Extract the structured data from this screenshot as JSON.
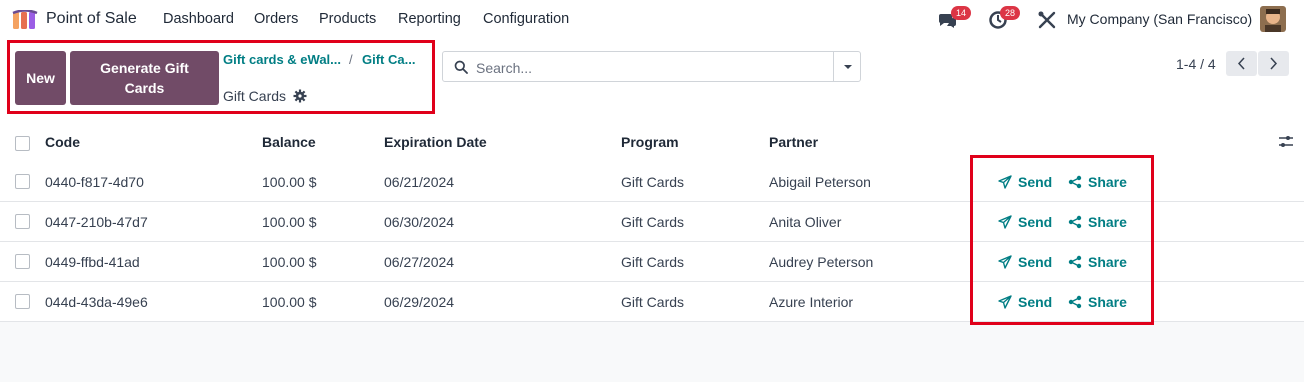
{
  "app": {
    "name": "Point of Sale"
  },
  "menu": [
    "Dashboard",
    "Orders",
    "Products",
    "Reporting",
    "Configuration"
  ],
  "systray": {
    "messages_count": "14",
    "activities_count": "28",
    "company": "My Company (San Francisco)"
  },
  "control": {
    "new_label": "New",
    "generate_label_line1": "Generate Gift",
    "generate_label_line2": "Cards",
    "breadcrumbs": [
      "Gift cards & eWal...",
      "Gift Ca..."
    ],
    "breadcrumb_separator": "/",
    "view_title": "Gift Cards",
    "search_placeholder": "Search...",
    "pager": "1-4 / 4"
  },
  "table": {
    "columns": [
      "Code",
      "Balance",
      "Expiration Date",
      "Program",
      "Partner"
    ],
    "rows": [
      {
        "code": "0440-f817-4d70",
        "balance": "100.00 $",
        "expiration": "06/21/2024",
        "program": "Gift Cards",
        "partner": "Abigail Peterson"
      },
      {
        "code": "0447-210b-47d7",
        "balance": "100.00 $",
        "expiration": "06/30/2024",
        "program": "Gift Cards",
        "partner": "Anita Oliver"
      },
      {
        "code": "0449-ffbd-41ad",
        "balance": "100.00 $",
        "expiration": "06/27/2024",
        "program": "Gift Cards",
        "partner": "Audrey Peterson"
      },
      {
        "code": "044d-43da-49e6",
        "balance": "100.00 $",
        "expiration": "06/29/2024",
        "program": "Gift Cards",
        "partner": "Azure Interior"
      }
    ],
    "send_label": "Send",
    "share_label": "Share"
  },
  "colors": {
    "brand": "#714b67",
    "link": "#017e84",
    "badge": "#dc3545",
    "highlight": "#e0001a"
  }
}
